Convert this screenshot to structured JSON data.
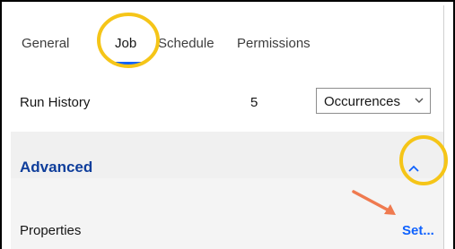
{
  "tabs": [
    {
      "label": "General"
    },
    {
      "label": "Job"
    },
    {
      "label": "Schedule"
    },
    {
      "label": "Permissions"
    }
  ],
  "run_history": {
    "label": "Run History",
    "count": "5",
    "unit_select": {
      "selected": "Occurrences"
    }
  },
  "advanced": {
    "label": "Advanced"
  },
  "properties": {
    "label": "Properties",
    "link": "Set..."
  },
  "colors": {
    "accent": "#0f62fe",
    "section_heading": "#0f3e9b",
    "highlight_circle": "#f5c518",
    "arrow": "#ef7a4f"
  }
}
